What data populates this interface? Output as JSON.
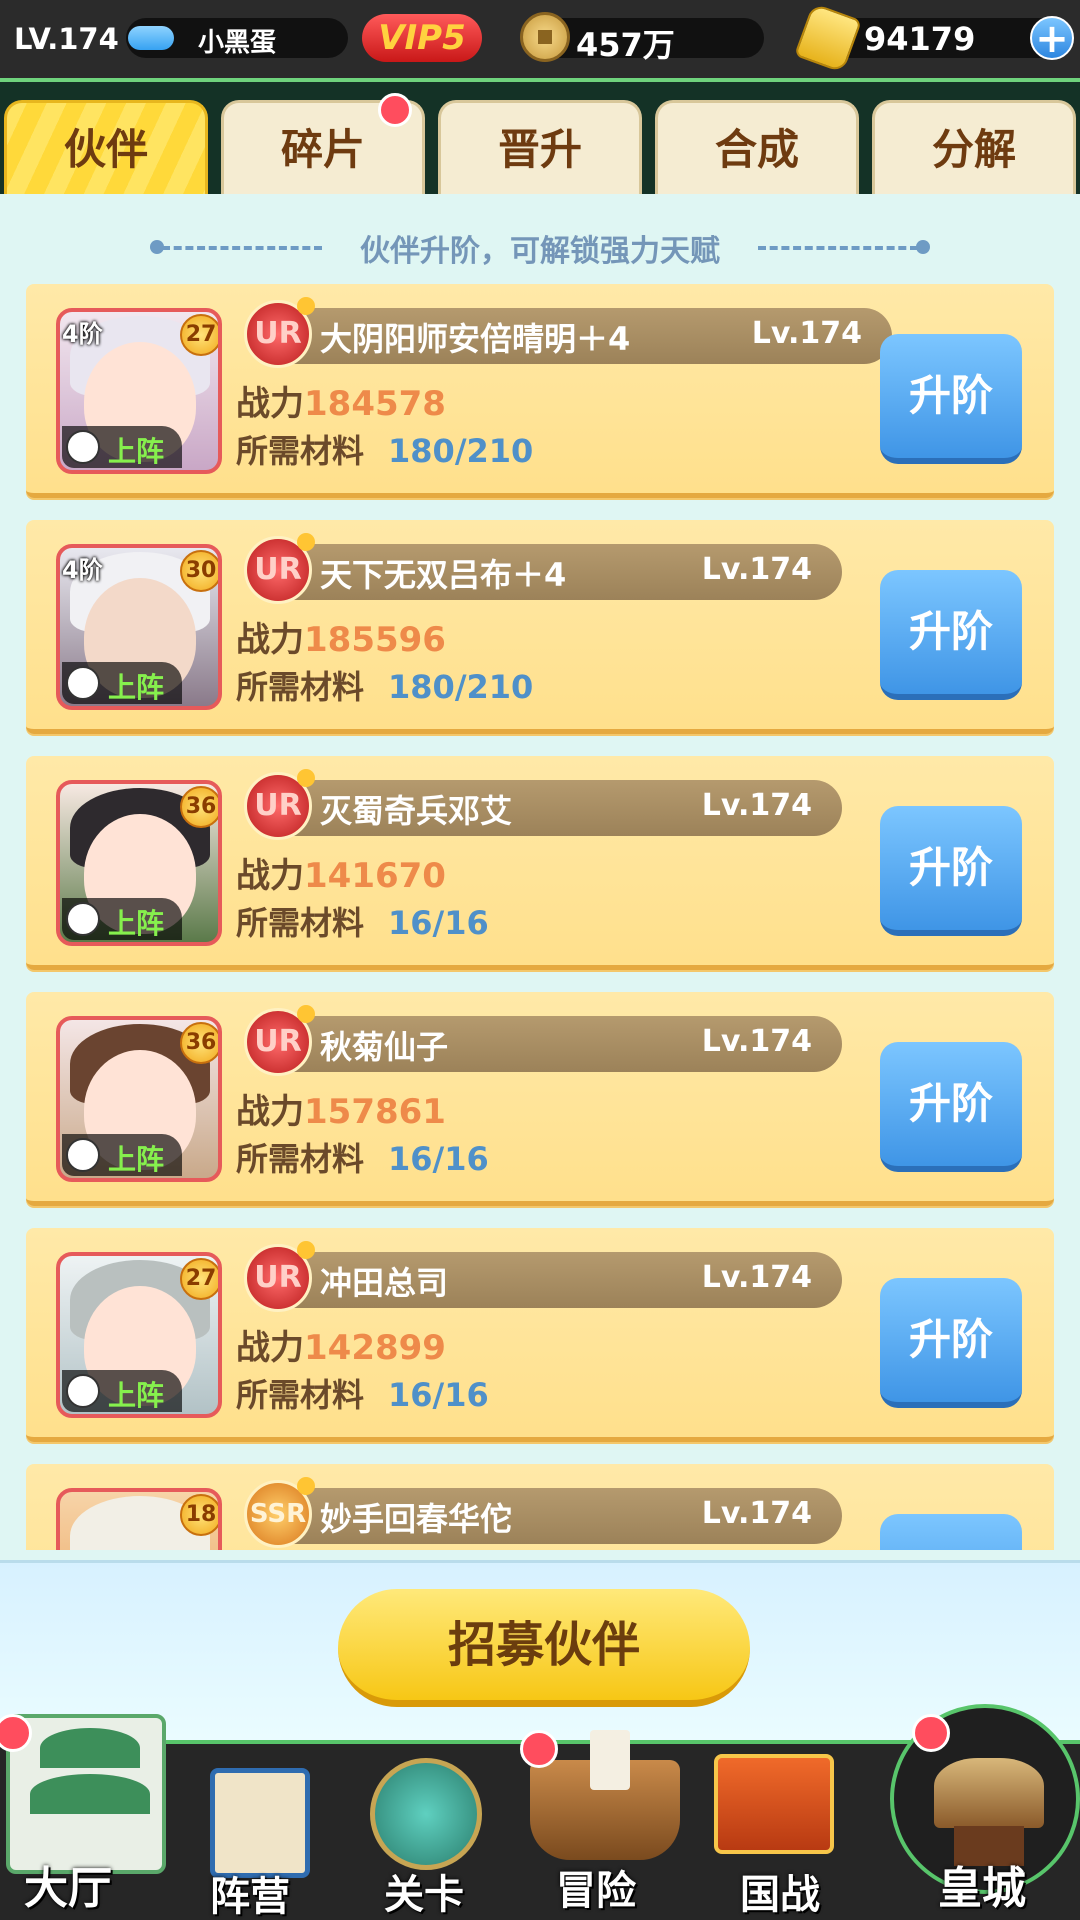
{
  "topbar": {
    "level": "LV.174",
    "player_name": "小黑蛋",
    "vip": "VIP5",
    "copper": "457万",
    "gold": "94179",
    "add_label": "+"
  },
  "tabs": [
    {
      "label": "伙伴",
      "active": true
    },
    {
      "label": "碎片",
      "badge": true
    },
    {
      "label": "晋升"
    },
    {
      "label": "合成"
    },
    {
      "label": "分解"
    }
  ],
  "subtitle": "伙伴升阶，可解锁强力天赋",
  "labels": {
    "power": "战力",
    "material": "所需材料",
    "deploy": "上阵",
    "upgrade": "升阶"
  },
  "partners": [
    {
      "rank": "4阶",
      "star": "27",
      "rarity": "UR",
      "name": "大阴阳师安倍晴明＋4",
      "level": "Lv.174",
      "power": "184578",
      "material": "180/210"
    },
    {
      "rank": "4阶",
      "star": "30",
      "rarity": "UR",
      "name": "天下无双吕布＋4",
      "level": "Lv.174",
      "power": "185596",
      "material": "180/210"
    },
    {
      "rank": "",
      "star": "36",
      "rarity": "UR",
      "name": "灭蜀奇兵邓艾",
      "level": "Lv.174",
      "power": "141670",
      "material": "16/16"
    },
    {
      "rank": "",
      "star": "36",
      "rarity": "UR",
      "name": "秋菊仙子",
      "level": "Lv.174",
      "power": "157861",
      "material": "16/16"
    },
    {
      "rank": "",
      "star": "27",
      "rarity": "UR",
      "name": "冲田总司",
      "level": "Lv.174",
      "power": "142899",
      "material": "16/16"
    },
    {
      "rank": "",
      "star": "18",
      "rarity": "SSR",
      "name": "妙手回春华佗",
      "level": "Lv.174",
      "power": "",
      "material": ""
    }
  ],
  "recruit_label": "招募伙伴",
  "nav": [
    {
      "label": "大厅",
      "badge": true
    },
    {
      "label": "阵营"
    },
    {
      "label": "关卡"
    },
    {
      "label": "冒险",
      "badge": true
    },
    {
      "label": "国战"
    },
    {
      "label": "皇城",
      "badge": true
    }
  ],
  "colors": {
    "accent_blue": "#3f95e6",
    "card_bg": "#ffe08c",
    "power_orange": "#ee8a4a",
    "material_blue": "#4f90c9",
    "badge_red": "#ff4d5e"
  }
}
